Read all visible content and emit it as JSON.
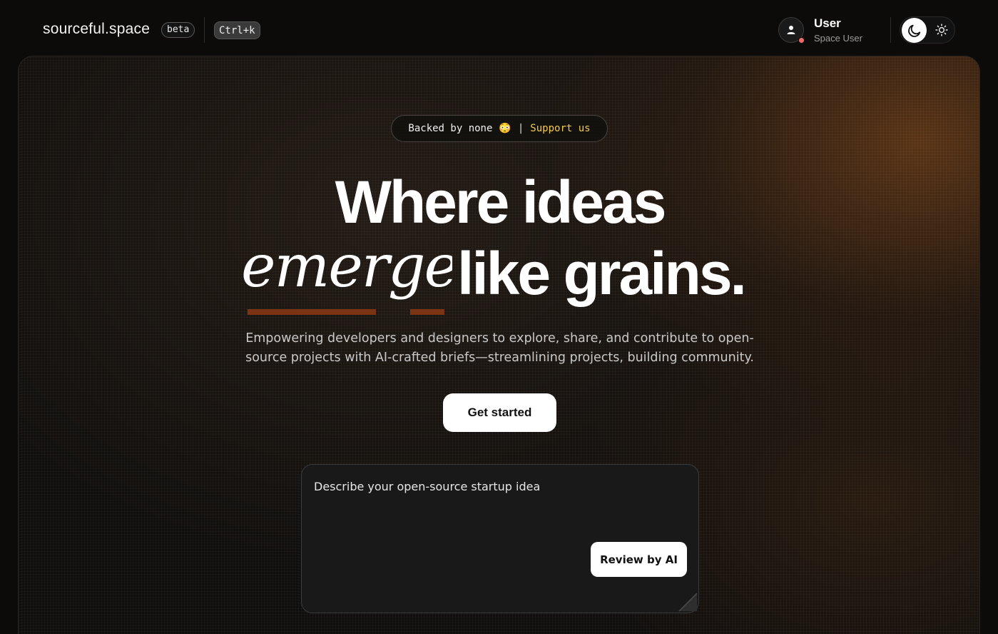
{
  "header": {
    "logo": "sourceful.space",
    "badge": "beta",
    "shortcut": "Ctrl+k",
    "user": {
      "name": "User",
      "role": "Space User",
      "status_color": "#ef6b6b"
    },
    "theme_toggle": {
      "active": "dark"
    }
  },
  "hero": {
    "pill": {
      "text": "Backed by none",
      "emoji": "😳",
      "separator": "|",
      "link": "Support us"
    },
    "headline_line1": "Where ideas",
    "headline_script": "emerge",
    "headline_line2": "like grains.",
    "subtitle": "Empowering developers and designers to explore, share, and contribute to open-source projects with AI-crafted briefs—streamlining projects, building community.",
    "cta": "Get started",
    "idea_input": {
      "value": "",
      "placeholder": "Describe your open-source startup idea"
    },
    "review_button": "Review by AI"
  },
  "colors": {
    "accent": "#f3c94a",
    "underline": "#7a3414",
    "background": "#0c0b0a"
  }
}
